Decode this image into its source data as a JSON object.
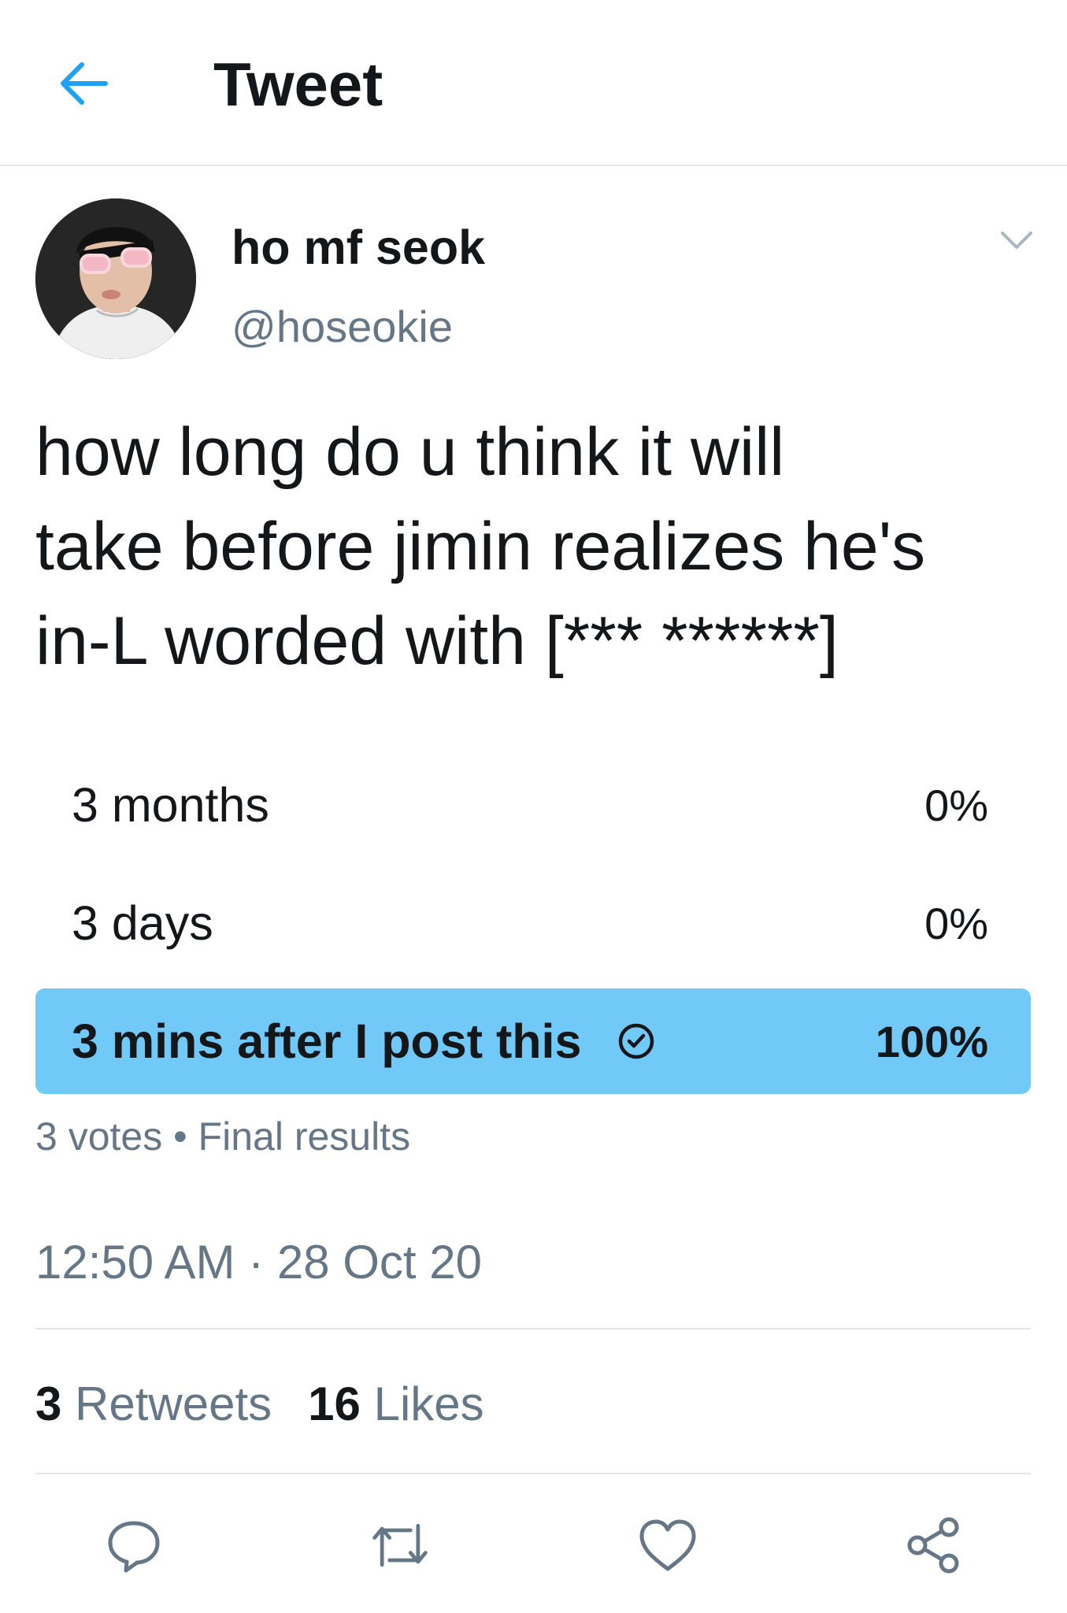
{
  "header": {
    "back_icon": "arrow-left-icon",
    "title": "Tweet",
    "accent_color": "#1da1f2"
  },
  "tweet": {
    "author": {
      "display_name": "ho mf seok",
      "handle": "@hoseokie"
    },
    "more_icon": "chevron-down-icon",
    "text": "how long do u think it will\ntake before jimin realizes he's\nin-L worded with [*** ******]",
    "poll": {
      "options": [
        {
          "label": "3 months",
          "percent_text": "0%",
          "percent": 0,
          "winner": false
        },
        {
          "label": "3 days",
          "percent_text": "0%",
          "percent": 0,
          "winner": false
        },
        {
          "label": "3 mins after I post this",
          "percent_text": "100%",
          "percent": 100,
          "winner": true
        }
      ],
      "winner_fill_color": "#71c9f8",
      "votes": "3 votes",
      "separator": "•",
      "status": "Final results"
    },
    "timestamp": "12:50 AM · 28 Oct 20",
    "stats": {
      "retweets_count": "3",
      "retweets_label": "Retweets",
      "likes_count": "16",
      "likes_label": "Likes"
    },
    "actions": [
      "reply-icon",
      "retweet-icon",
      "like-icon",
      "share-icon"
    ]
  }
}
